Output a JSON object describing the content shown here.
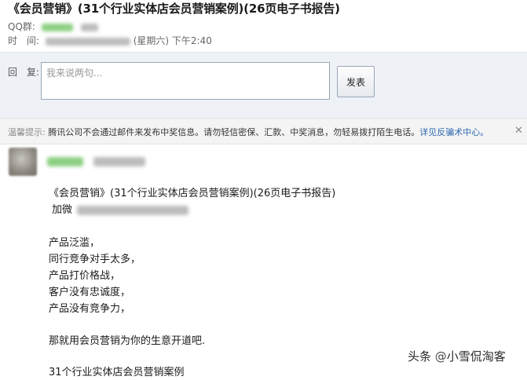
{
  "email": {
    "subject": "《会员营销》(31个行业实体店会员营销案例)(26页电子书报告)",
    "star_icon": "star-icon",
    "qq_label": "QQ群:",
    "time_label": "时　间:",
    "time_text": "(星期六) 下午2:40"
  },
  "reply": {
    "label": "回　复:",
    "placeholder": "我来说两句...",
    "send_label": "发表"
  },
  "tip": {
    "prefix": "温馨提示:",
    "text": "腾讯公司不会通过邮件来发布中奖信息。请勿轻信密保、汇款、中奖消息，勿轻易拨打陌生电话。",
    "link": "详见反骗术中心。",
    "close_icon": "close-icon"
  },
  "body_lines": {
    "title": "《会员营销》(31个行业实体店会员营销案例)(26页电子书报告)",
    "contact": "加微",
    "p1": "产品泛滥，",
    "p2": "同行竞争对手太多，",
    "p3": "产品打价格战，",
    "p4": "客户没有忠诚度，",
    "p5": "产品没有竞争力，",
    "p6": "那就用会员营销为你的生意开道吧.",
    "p7": "31个行业实体店会员营销案例"
  },
  "watermark": {
    "prefix": "头条",
    "at": "@",
    "name": "小雪侃淘客"
  },
  "colors": {
    "link": "#2a67b1",
    "reply_bg": "#eef2f7",
    "tip_bg": "#f4f4f4"
  }
}
